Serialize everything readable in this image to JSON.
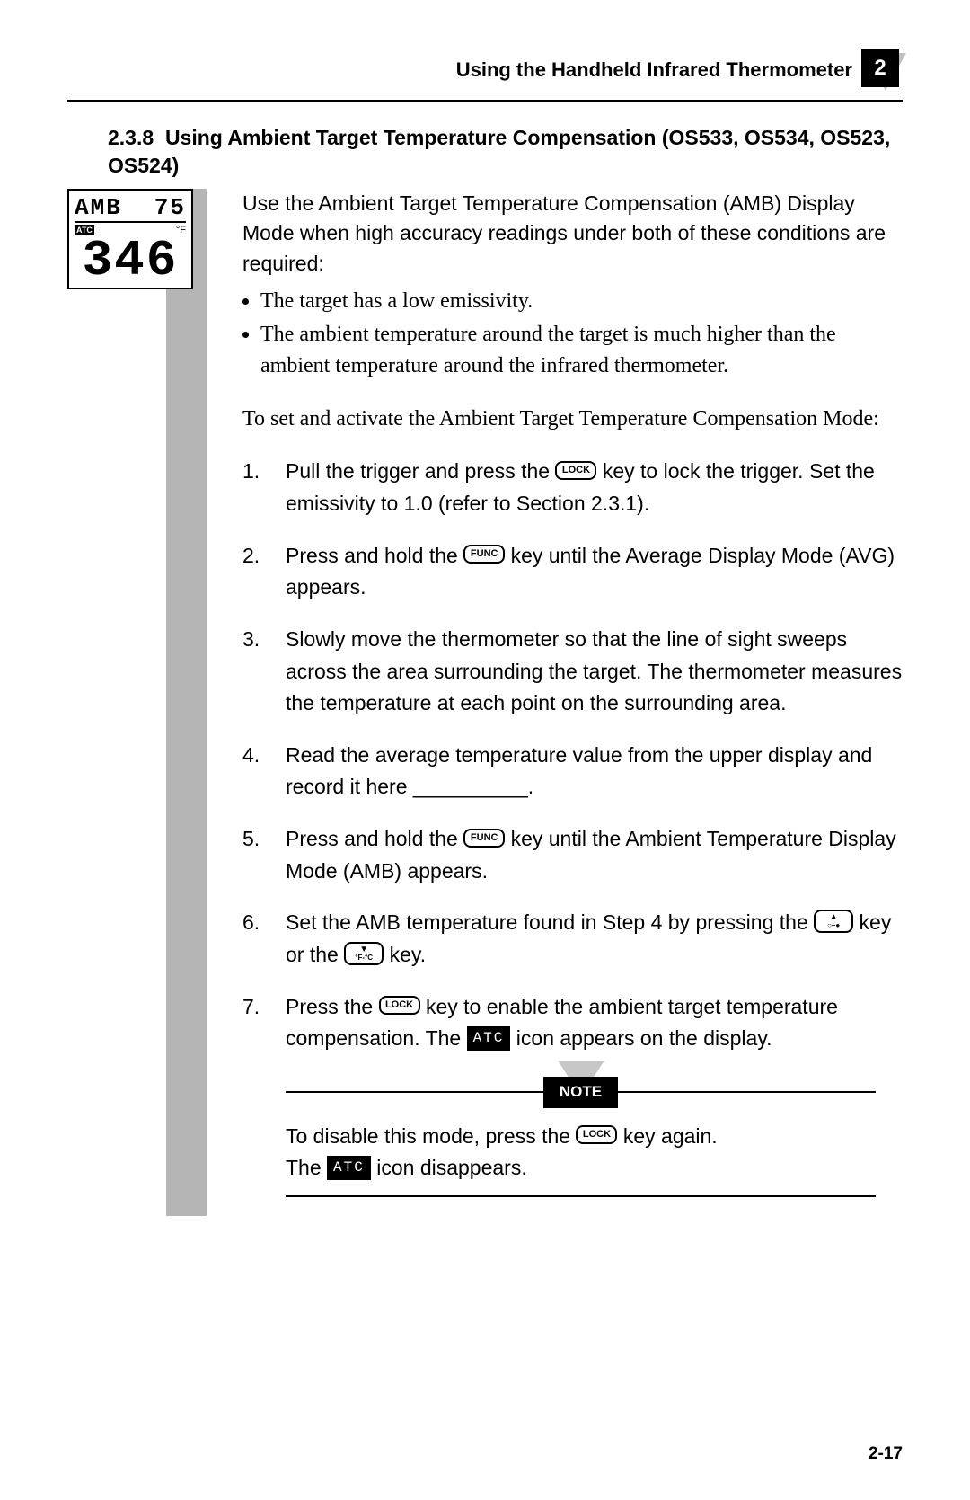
{
  "header": {
    "title": "Using the Handheld Infrared Thermometer",
    "chapter": "2"
  },
  "section": {
    "number": "2.3.8",
    "title": "Using Ambient Target Temperature Compensation (OS533, OS534, OS523, OS524)"
  },
  "lcd": {
    "top_label": "AMB",
    "top_value": "75",
    "atc": "ATC",
    "unit": "°F",
    "main": "346"
  },
  "intro": "Use the Ambient Target Temperature Compensation (AMB) Display Mode when high accuracy readings under both of these conditions are required:",
  "bullets": [
    "The target has a low emissivity.",
    "The ambient temperature around the target is much higher than the ambient temperature around the infrared thermometer."
  ],
  "lead": "To set and activate the Ambient Target Temperature Compensation Mode:",
  "keys": {
    "lock": "LOCK",
    "func": "FUNC",
    "up_sub": "○–●",
    "down_sub": "°F-°C",
    "atc_chip": "ATC"
  },
  "steps": {
    "s1a": "Pull the trigger and press the ",
    "s1b": " key to lock the trigger. Set the emissivity to 1.0 (refer to Section 2.3.1).",
    "s2a": "Press and hold the ",
    "s2b": " key until the Average Display Mode (AVG) appears.",
    "s3": "Slowly move the thermometer so that the line of sight sweeps across the area surrounding the target.  The thermometer measures the temperature at each point on the surrounding area.",
    "s4": "Read the average temperature value from the upper display and record it here __________.",
    "s5a": "Press and hold the ",
    "s5b": " key until the Ambient Temperature Display Mode (AMB) appears.",
    "s6a": "Set the AMB temperature found in Step 4 by pressing the ",
    "s6mid": " key or the ",
    "s6b": " key.",
    "s7a": "Press the ",
    "s7b": " key to enable the ambient target temperature compensation. The ",
    "s7c": " icon appears on the display."
  },
  "note": {
    "label": "NOTE",
    "line1a": "To disable this mode, press the ",
    "line1b": " key again.",
    "line2a": "The ",
    "line2b": " icon disappears."
  },
  "page_num": "2-17"
}
